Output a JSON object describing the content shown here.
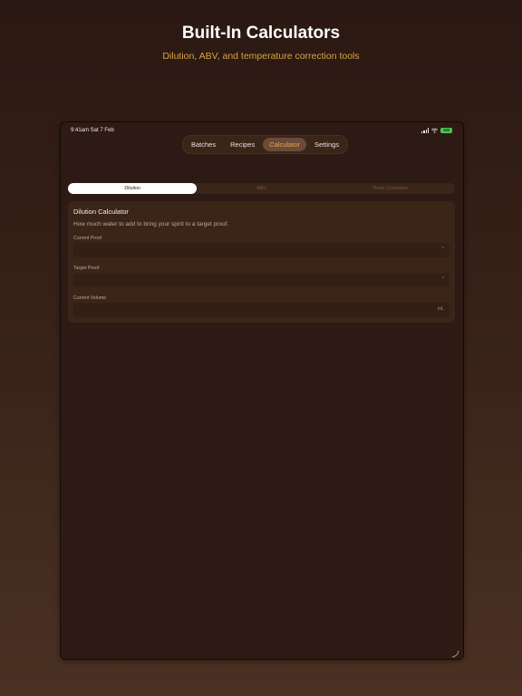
{
  "header": {
    "title": "Built-In Calculators",
    "subtitle": "Dilution, ABV, and temperature correction tools"
  },
  "status_bar": {
    "time_date": "9:41am   Sat 7 Feb",
    "battery_label": "100"
  },
  "tabs": [
    {
      "label": "Batches",
      "active": false
    },
    {
      "label": "Recipes",
      "active": false
    },
    {
      "label": "Calculator",
      "active": true
    },
    {
      "label": "Settings",
      "active": false
    }
  ],
  "segments": [
    {
      "label": "Dilution",
      "active": true
    },
    {
      "label": "ABV",
      "active": false
    },
    {
      "label": "Temp Correction",
      "active": false
    }
  ],
  "calculator": {
    "title": "Dilution Calculator",
    "description": "How much water to add to bring your spirit to a target proof.",
    "fields": [
      {
        "label": "Current Proof",
        "value": "",
        "unit": "°"
      },
      {
        "label": "Target Proof",
        "value": "",
        "unit": "°"
      },
      {
        "label": "Current Volume",
        "value": "",
        "unit": "mL"
      }
    ]
  },
  "colors": {
    "accent": "#e8a851",
    "subtitle": "#d9a441",
    "battery": "#4ec45a",
    "background": "#2e1a14",
    "card": "#3b2519"
  }
}
